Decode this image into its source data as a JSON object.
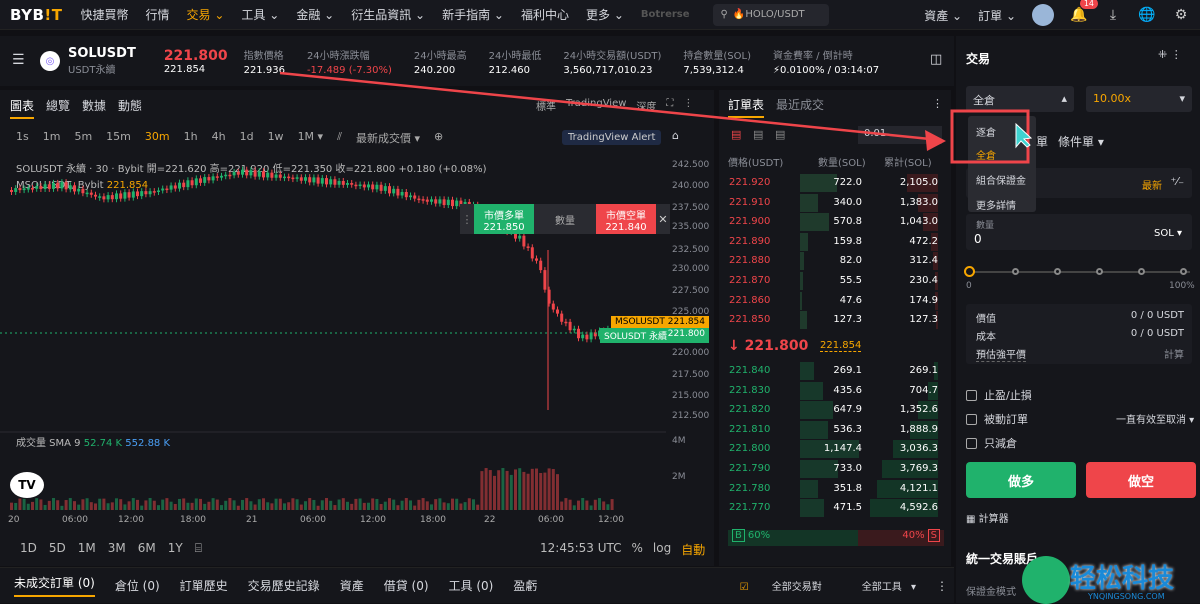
{
  "nav": {
    "logo_a": "BYB",
    "logo_b": "!T",
    "items": [
      "快捷買幣",
      "行情",
      "交易",
      "工具",
      "金融",
      "衍生品資訊",
      "新手指南",
      "福利中心",
      "更多"
    ],
    "brand": "Botrerse",
    "search": "🔥HOLO/USDT",
    "right": [
      "資產",
      "訂單"
    ],
    "badge": "14"
  },
  "ticker": {
    "symbol": "SOLUSDT",
    "sub": "USDT永續",
    "price": "221.800",
    "mark": "221.854",
    "stats": [
      {
        "k": "指數價格",
        "v": "221.936"
      },
      {
        "k": "24小時漲跌幅",
        "v": "-17.489 (-7.30%)"
      },
      {
        "k": "24小時最高",
        "v": "240.200"
      },
      {
        "k": "24小時最低",
        "v": "212.460"
      },
      {
        "k": "24小時交易額(USDT)",
        "v": "3,560,717,010.23"
      },
      {
        "k": "持倉數量(SOL)",
        "v": "7,539,312.4"
      },
      {
        "k": "資金費率 / 倒計時",
        "v": "⚡0.0100% / 03:14:07"
      }
    ]
  },
  "chart": {
    "tabs": [
      "圖表",
      "總覽",
      "數據",
      "動態"
    ],
    "right_tabs": [
      "標準",
      "TradingView",
      "深度"
    ],
    "timeframes": [
      "1s",
      "1m",
      "5m",
      "15m",
      "30m",
      "1h",
      "4h",
      "1d",
      "1w",
      "1M"
    ],
    "latest": "最新成交價",
    "tv_alert": "TradingView Alert",
    "legend1": "SOLUSDT 永續 · 30 · Bybit  開=221.620  高=221.920  低=221.350  收=221.800  +0.180 (+0.08%)",
    "legend2_a": "MSOLUSDT, Bybit",
    "legend2_b": "221.854",
    "vol_a": "成交量 SMA 9",
    "vol_b": "52.74 K",
    "vol_c": "552.88 K",
    "buy_label": "市價多單",
    "buy_price": "221.850",
    "qty": "數量",
    "sell_label": "市價空單",
    "sell_price": "221.840",
    "tag_m": "MSOLUSDT",
    "tag_m_v": "221.854",
    "tag_s": "SOLUSDT 永續",
    "tag_s_v": "221.800",
    "yticks": [
      "242.500",
      "240.000",
      "237.500",
      "235.000",
      "232.500",
      "230.000",
      "227.500",
      "225.000",
      "222.500",
      "220.000",
      "217.500",
      "215.000",
      "212.500",
      "4M",
      "2M"
    ],
    "xticks": [
      "20",
      "06:00",
      "12:00",
      "18:00",
      "21",
      "06:00",
      "12:00",
      "18:00",
      "22",
      "06:00",
      "12:00"
    ],
    "ranges": [
      "1D",
      "5D",
      "1M",
      "3M",
      "6M",
      "1Y"
    ],
    "clock": "12:45:53 UTC",
    "pct": "%",
    "log": "log",
    "auto": "自動"
  },
  "orderbook": {
    "tabs": [
      "訂單表",
      "最近成交"
    ],
    "step": "0.01",
    "headers": [
      "價格(USDT)",
      "數量(SOL)",
      "累計(SOL)"
    ],
    "asks": [
      [
        "221.920",
        "722.0",
        "2,105.0"
      ],
      [
        "221.910",
        "340.0",
        "1,383.0"
      ],
      [
        "221.900",
        "570.8",
        "1,043.0"
      ],
      [
        "221.890",
        "159.8",
        "472.2"
      ],
      [
        "221.880",
        "82.0",
        "312.4"
      ],
      [
        "221.870",
        "55.5",
        "230.4"
      ],
      [
        "221.860",
        "47.6",
        "174.9"
      ],
      [
        "221.850",
        "127.3",
        "127.3"
      ]
    ],
    "last": "↓ 221.800",
    "last_mark": "221.854",
    "bids": [
      [
        "221.840",
        "269.1",
        "269.1"
      ],
      [
        "221.830",
        "435.6",
        "704.7"
      ],
      [
        "221.820",
        "647.9",
        "1,352.6"
      ],
      [
        "221.810",
        "536.3",
        "1,888.9"
      ],
      [
        "221.800",
        "1,147.4",
        "3,036.3"
      ],
      [
        "221.790",
        "733.0",
        "3,769.3"
      ],
      [
        "221.780",
        "351.8",
        "4,121.1"
      ],
      [
        "221.770",
        "471.5",
        "4,592.6"
      ]
    ],
    "buy_pct": "60%",
    "sell_pct": "40%"
  },
  "trade": {
    "title": "交易",
    "margin": "全倉",
    "leverage": "10.00x",
    "menu": [
      "逐倉",
      "全倉",
      "組合保證金",
      "更多詳情"
    ],
    "order_types": [
      "單",
      "條件單"
    ],
    "latest": "最新",
    "qty_label": "數量",
    "qty": "0",
    "unit": "SOL",
    "slider_min": "0",
    "slider_max": "100%",
    "value_label": "價值",
    "value": "0 / 0 USDT",
    "cost_label": "成本",
    "cost": "0 / 0 USDT",
    "liq_label": "預估強平價",
    "liq": "計算",
    "tpsl": "止盈/止損",
    "post": "被動訂單",
    "tif": "一直有效至取消",
    "reduce": "只減倉",
    "long": "做多",
    "short": "做空",
    "calc": "計算器",
    "unified": "統一交易賬戶",
    "margin_mode": "保證金模式"
  },
  "bottom": {
    "tabs": [
      "未成交訂單 (0)",
      "倉位 (0)",
      "訂單歷史",
      "交易歷史記錄",
      "資產",
      "借貸 (0)",
      "工具 (0)",
      "盈虧"
    ],
    "all_pairs": "全部交易對",
    "all_tools": "全部工具"
  },
  "watermark": {
    "cn": "轻松科技",
    "en": "YNQINGSONG.COM"
  },
  "colors": {
    "accent": "#f7a600",
    "up": "#20b26c",
    "down": "#ef454a",
    "bg": "#101014"
  }
}
